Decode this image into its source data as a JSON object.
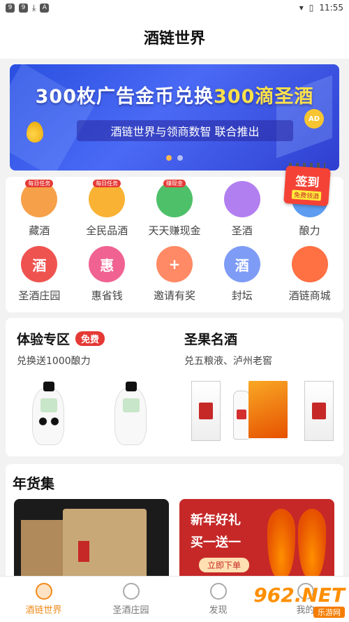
{
  "statusbar": {
    "time": "11:55",
    "icons": [
      "app-icon-a",
      "app-icon-b",
      "download-icon",
      "a-icon"
    ]
  },
  "header": {
    "title": "酒链世界"
  },
  "banner": {
    "headline_white_1": "300枚广告金币兑换",
    "headline_yellow": "300滴圣酒",
    "subline": "酒链世界与领商数智 联合推出",
    "coin_text": "AD",
    "pages": 2,
    "active_page": 0
  },
  "grid": {
    "items": [
      {
        "label": "藏酒",
        "tag": "每日任务",
        "color": "#f7a04a",
        "glyph": ""
      },
      {
        "label": "全民品酒",
        "tag": "每日任务",
        "color": "#f9b233",
        "glyph": ""
      },
      {
        "label": "天天赚现金",
        "tag": "赚现金",
        "color": "#4fc06a",
        "glyph": ""
      },
      {
        "label": "圣酒",
        "tag": "",
        "color": "#b27ff0",
        "glyph": ""
      },
      {
        "label": "酿力",
        "tag": "",
        "color": "#5d9cf0",
        "glyph": ""
      },
      {
        "label": "圣酒庄园",
        "tag": "",
        "color": "#ef5350",
        "glyph": "酒"
      },
      {
        "label": "惠省钱",
        "tag": "",
        "color": "#f06292",
        "glyph": "惠"
      },
      {
        "label": "邀请有奖",
        "tag": "",
        "color": "#ff8a65",
        "glyph": "+"
      },
      {
        "label": "封坛",
        "tag": "",
        "color": "#7e9cf5",
        "glyph": "酒"
      },
      {
        "label": "酒链商城",
        "tag": "",
        "color": "#ff7043",
        "glyph": ""
      }
    ],
    "signin": {
      "title": "签到",
      "sub": "免费领酒"
    }
  },
  "promos": {
    "left": {
      "title": "体验专区",
      "badge": "免费",
      "subtitle": "兑换送1000酿力"
    },
    "right": {
      "title": "圣果名酒",
      "subtitle": "兑五粮液、泸州老窖"
    }
  },
  "section": {
    "title": "年货集",
    "card2": {
      "line1": "新年好礼",
      "line2": "买一送一",
      "cta": "立即下单"
    }
  },
  "tabbar": {
    "tabs": [
      {
        "label": "酒链世界",
        "active": true
      },
      {
        "label": "圣酒庄园",
        "active": false
      },
      {
        "label": "发现",
        "active": false
      },
      {
        "label": "我的",
        "active": false
      }
    ]
  },
  "watermark": {
    "brand": "962.NET",
    "sub": "乐游网"
  },
  "colors": {
    "accent": "#f08a1a",
    "badge_red": "#e53935"
  }
}
